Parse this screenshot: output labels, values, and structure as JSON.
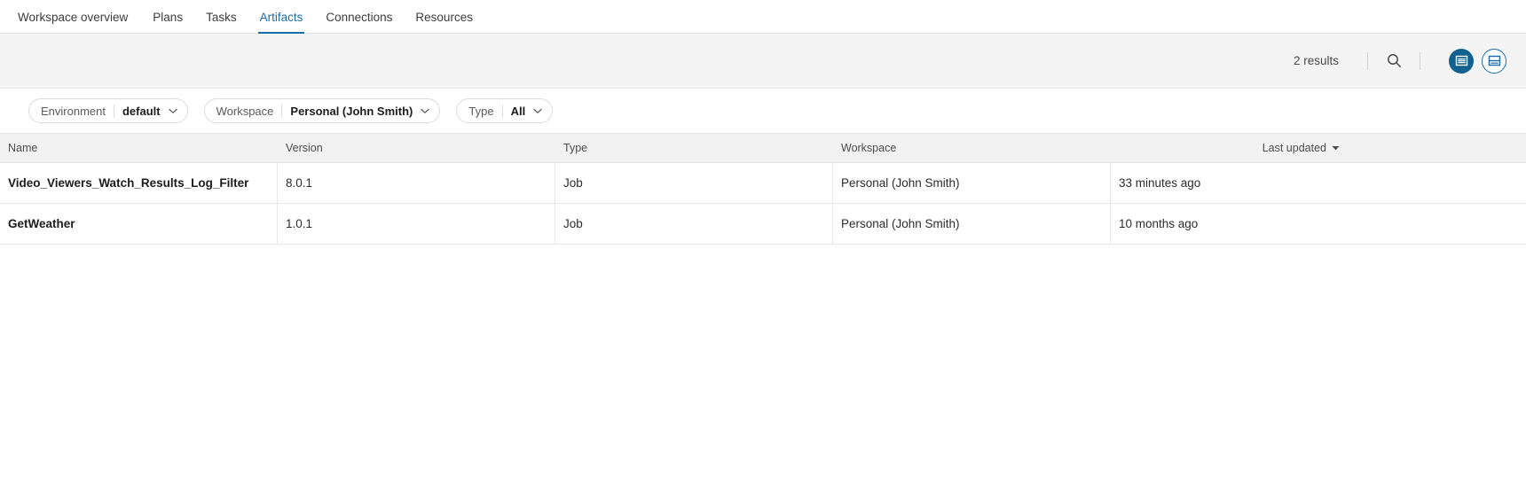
{
  "nav": {
    "tabs": [
      {
        "label": "Workspace overview",
        "active": false
      },
      {
        "label": "Plans",
        "active": false
      },
      {
        "label": "Tasks",
        "active": false
      },
      {
        "label": "Artifacts",
        "active": true
      },
      {
        "label": "Connections",
        "active": false
      },
      {
        "label": "Resources",
        "active": false
      }
    ],
    "accent_color": "#1a6ca8"
  },
  "toolbar": {
    "results_text": "2 results",
    "search_icon": "search-icon",
    "view_list_icon": "list-view-icon",
    "view_split_icon": "split-view-icon",
    "active_view": "list",
    "filled_color": "#10618f",
    "outline_color": "#1a6ca8"
  },
  "filters": [
    {
      "label": "Environment",
      "value": "default",
      "caret": "chevron-down-icon"
    },
    {
      "label": "Workspace",
      "value": "Personal (John Smith)",
      "caret": "chevron-down-icon"
    },
    {
      "label": "Type",
      "value": "All",
      "caret": "chevron-down-icon"
    }
  ],
  "table": {
    "columns": [
      {
        "label": "Name"
      },
      {
        "label": "Version"
      },
      {
        "label": "Type"
      },
      {
        "label": "Workspace"
      },
      {
        "label": "Last updated",
        "sorted": "desc",
        "sort_icon": "sort-desc-caret-icon"
      }
    ],
    "rows": [
      {
        "name": "Video_Viewers_Watch_Results_Log_Filter",
        "version": "8.0.1",
        "type": "Job",
        "workspace": "Personal (John Smith)",
        "last_updated": "33 minutes ago"
      },
      {
        "name": "GetWeather",
        "version": "1.0.1",
        "type": "Job",
        "workspace": "Personal (John Smith)",
        "last_updated": "10 months ago"
      }
    ]
  }
}
